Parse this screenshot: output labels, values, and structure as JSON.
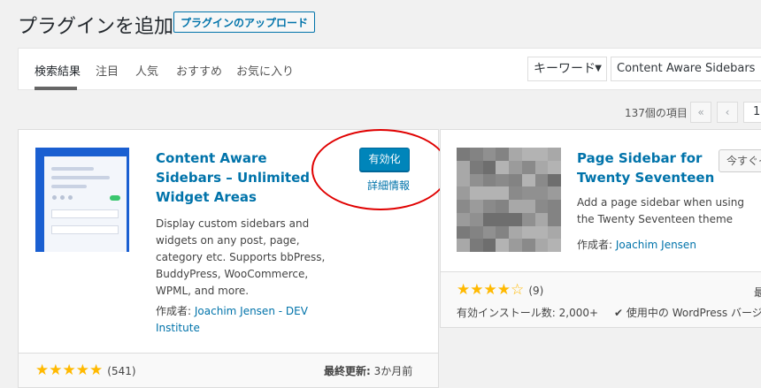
{
  "header": {
    "title": "プラグインを追加",
    "upload_button": "プラグインのアップロード"
  },
  "filter": {
    "tabs": [
      {
        "label": "検索結果",
        "current": true
      },
      {
        "label": "注目",
        "current": false
      },
      {
        "label": "人気",
        "current": false
      },
      {
        "label": "おすすめ",
        "current": false
      },
      {
        "label": "お気に入り",
        "current": false
      }
    ],
    "search_type": "キーワード",
    "search_value": "Content Aware Sidebars"
  },
  "pagination": {
    "items_count": "137個の項目",
    "first": "«",
    "prev": "‹",
    "current_page": "1"
  },
  "plugins": [
    {
      "title_lines": [
        "Content Aware",
        "Sidebars – Unlimited",
        "Widget Areas"
      ],
      "action_button": "有効化",
      "details_link": "詳細情報",
      "description_lines": [
        "Display custom sidebars and",
        "widgets on any post, page,",
        "category etc. Supports bbPress,",
        "BuddyPress, WooCommerce,",
        "WPML, and more."
      ],
      "author_label": "作成者:",
      "author_lines": [
        "Joachim Jensen - DEV",
        "Institute"
      ],
      "stars": "★★★★★",
      "rating_count": "(541)",
      "last_updated_label": "最終更新:",
      "last_updated_value": "3か月前",
      "icon": "content-aware-sidebars-logo"
    },
    {
      "title_lines": [
        "Page Sidebar for",
        "Twenty Seventeen"
      ],
      "action_button": "今すぐイ",
      "description_lines": [
        "Add a page sidebar when using",
        "the Twenty Seventeen theme"
      ],
      "author_label": "作成者:",
      "author_lines": [
        "Joachim Jensen"
      ],
      "stars": "★★★★",
      "empty_star": "☆",
      "rating_count": "(9)",
      "active_installs": "有効インストール数: 2,000+",
      "compat_check": "✔",
      "compat_text": "使用中の WordPress バージョ",
      "last_updated_clip": "最",
      "icon": "pixelated-thumbnail"
    }
  ],
  "colors": {
    "accent": "#0073aa",
    "button": "#0085ba",
    "star": "#ffb900",
    "annotation": "#e00000"
  }
}
